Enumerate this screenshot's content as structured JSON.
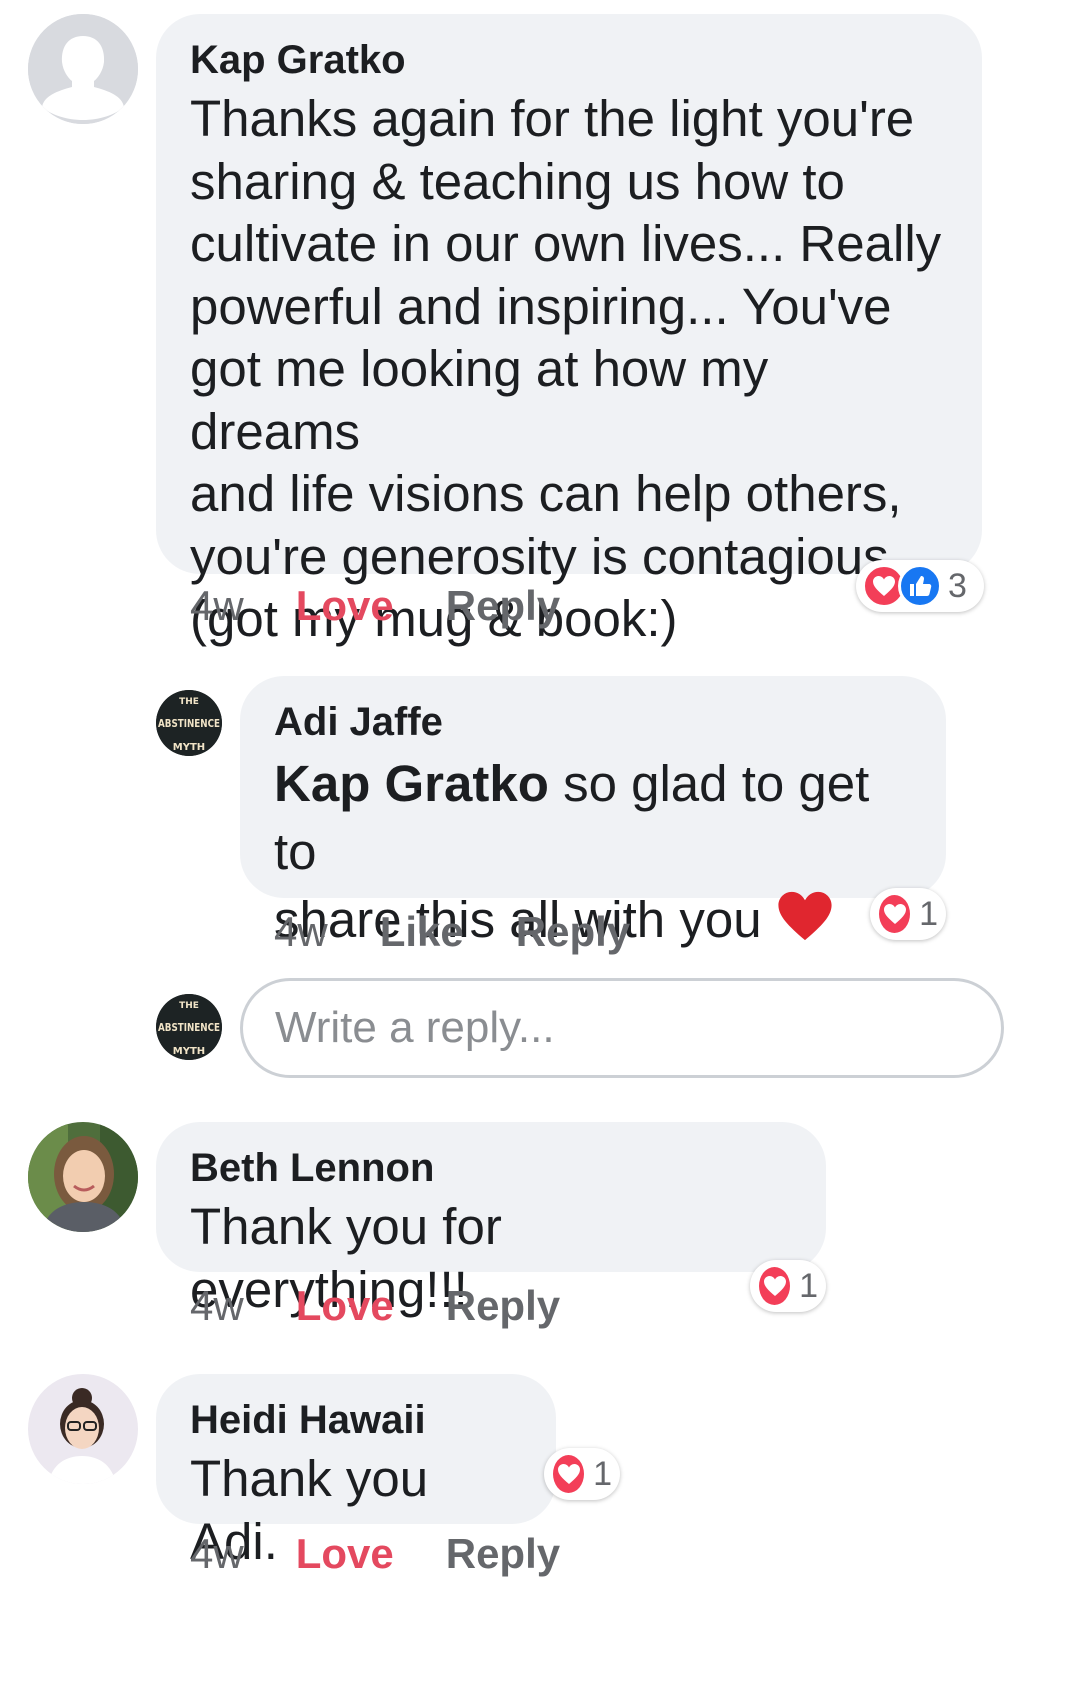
{
  "comments": [
    {
      "author": "Kap Gratko",
      "text": "Thanks again for the light you're\nsharing & teaching us how to\ncultivate in our own lives... Really\npowerful and inspiring... You've\ngot me looking at how my dreams\nand life visions can help others,\nyou're generosity is contagious...\n(got my mug & book:)",
      "time": "4w",
      "action_love": "Love",
      "action_reply": "Reply",
      "reaction_count": "3"
    },
    {
      "author": "Beth Lennon",
      "text": "Thank you for everything!!!",
      "time": "4w",
      "action_love": "Love",
      "action_reply": "Reply",
      "reaction_count": "1"
    },
    {
      "author": "Heidi Hawaii",
      "text": "Thank you Adi.",
      "time": "4w",
      "action_love": "Love",
      "action_reply": "Reply",
      "reaction_count": "1"
    }
  ],
  "reply": {
    "author": "Adi Jaffe",
    "mention": "Kap Gratko",
    "text": " so glad to get to\nshare this all with you ",
    "emoji": "❤️",
    "time": "4w",
    "action_like": "Like",
    "action_reply": "Reply",
    "reaction_count": "1"
  },
  "reply_input": {
    "placeholder": "Write a reply..."
  },
  "page_avatar_text": {
    "line1": "THE",
    "line2": "ABSTINENCE",
    "line3": "MYTH"
  },
  "colors": {
    "love": "#e4495f",
    "heart": "#f33e58",
    "like": "#1877f2",
    "bubble": "#f0f2f5"
  }
}
